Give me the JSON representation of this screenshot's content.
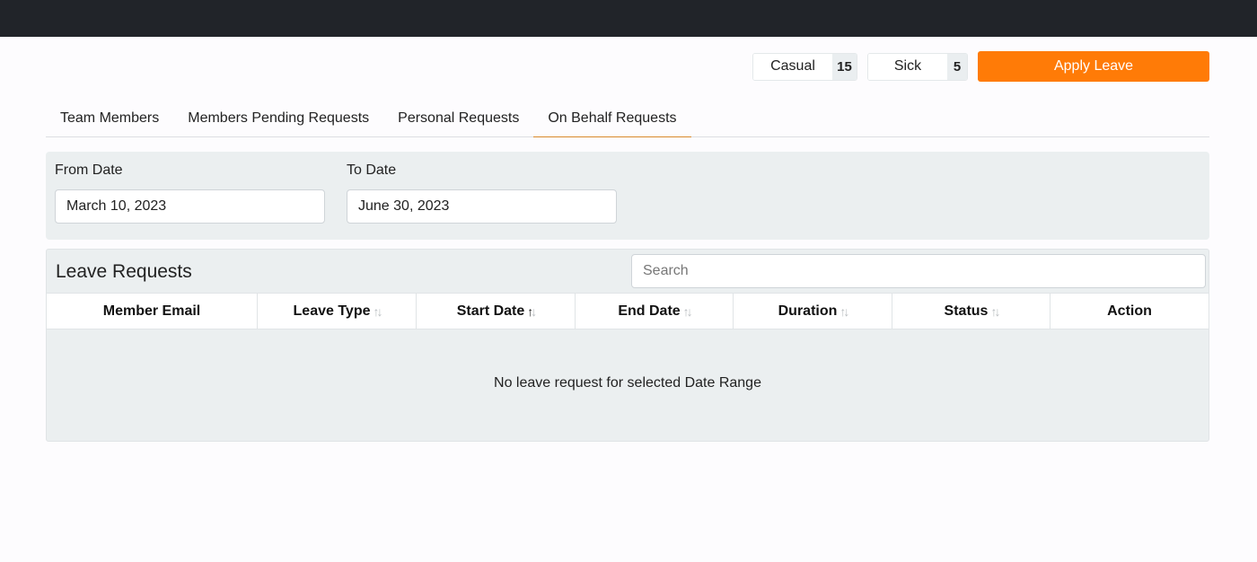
{
  "balances": {
    "casual": {
      "label": "Casual",
      "count": "15"
    },
    "sick": {
      "label": "Sick",
      "count": "5"
    }
  },
  "apply_label": "Apply Leave",
  "tabs": [
    {
      "label": "Team Members",
      "active": false
    },
    {
      "label": "Members Pending Requests",
      "active": false
    },
    {
      "label": "Personal Requests",
      "active": false
    },
    {
      "label": "On Behalf Requests",
      "active": true
    }
  ],
  "filters": {
    "from_label": "From Date",
    "from_value": "March 10, 2023",
    "to_label": "To Date",
    "to_value": "June 30, 2023"
  },
  "panel": {
    "title": "Leave Requests",
    "search_placeholder": "Search",
    "columns": [
      {
        "label": "Member Email",
        "sortable": false
      },
      {
        "label": "Leave Type",
        "sortable": true,
        "sort": "none"
      },
      {
        "label": "Start Date",
        "sortable": true,
        "sort": "asc"
      },
      {
        "label": "End Date",
        "sortable": true,
        "sort": "none"
      },
      {
        "label": "Duration",
        "sortable": true,
        "sort": "none"
      },
      {
        "label": "Status",
        "sortable": true,
        "sort": "none"
      },
      {
        "label": "Action",
        "sortable": false
      }
    ],
    "empty_message": "No leave request for selected Date Range"
  },
  "colors": {
    "accent": "#ff7b07",
    "topbar": "#212429",
    "tab_underline": "#d98a2b",
    "panel_bg": "#ebeff0"
  }
}
